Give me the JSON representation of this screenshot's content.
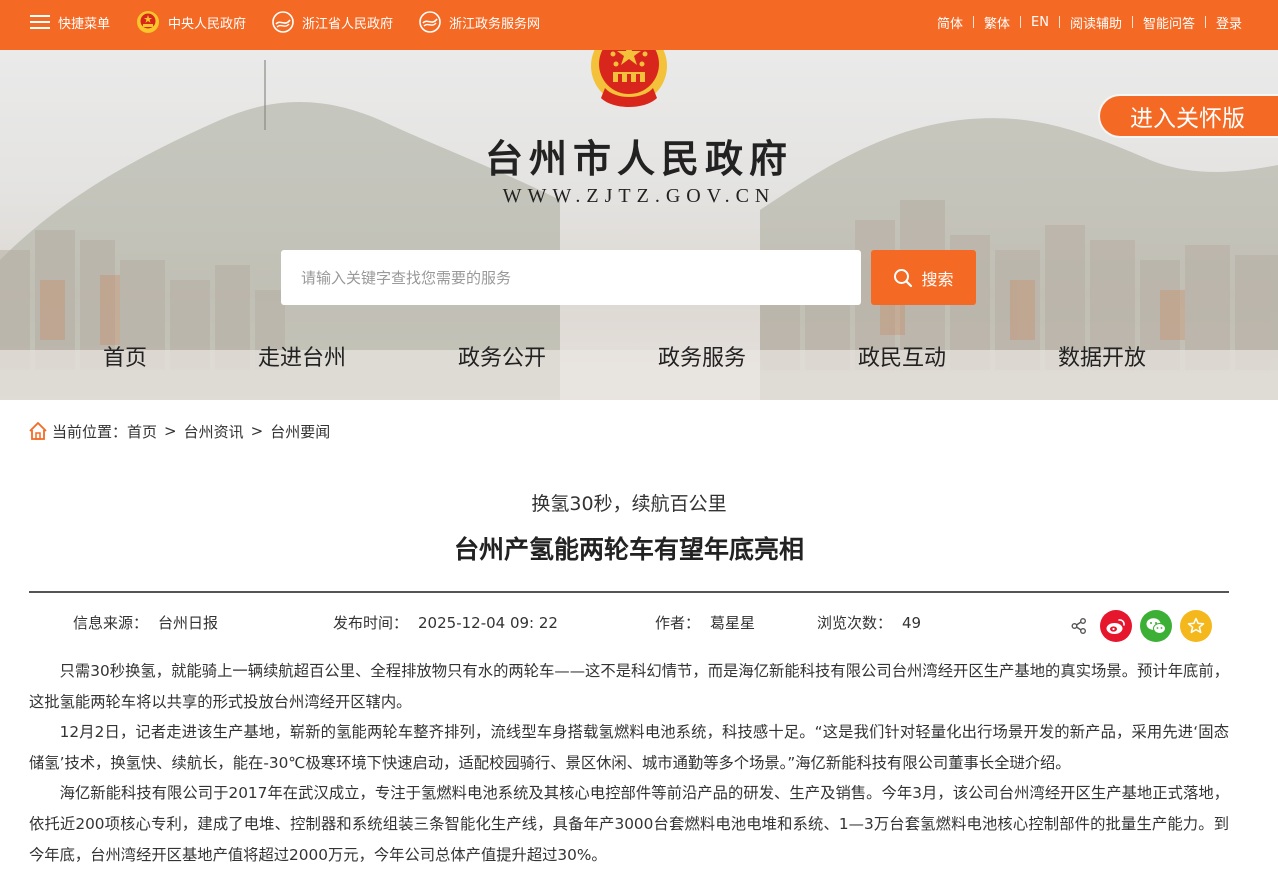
{
  "topbar": {
    "left": [
      {
        "label": "快捷菜单",
        "icon": "menu-icon"
      },
      {
        "label": "中央人民政府",
        "icon": "national-emblem-icon"
      },
      {
        "label": "浙江省人民政府",
        "icon": "zhejiang-logo-icon"
      },
      {
        "label": "浙江政务服务网",
        "icon": "zhejiang-service-logo-icon"
      }
    ],
    "right": [
      "简体",
      "繁体",
      "EN",
      "阅读辅助",
      "智能问答",
      "登录"
    ]
  },
  "banner": {
    "title": "台州市人民政府",
    "url": "WWW.ZJTZ.GOV.CN",
    "care_button": "进入关怀版",
    "search_placeholder": "请输入关键字查找您需要的服务",
    "search_button": "搜索"
  },
  "nav": [
    "首页",
    "走进台州",
    "政务公开",
    "政务服务",
    "政民互动",
    "数据开放"
  ],
  "breadcrumb": {
    "prefix": "当前位置：",
    "items": [
      "首页",
      "台州资讯",
      "台州要闻"
    ],
    "separator": ">"
  },
  "article": {
    "subtitle": "换氢30秒，续航百公里",
    "title": "台州产氢能两轮车有望年底亮相",
    "meta": {
      "source_label": "信息来源：",
      "source": "台州日报",
      "date_label": "发布时间：",
      "date": "2025-12-04 09: 22",
      "author_label": "作者：",
      "author": "葛星星",
      "views_label": "浏览次数：",
      "views": "49"
    },
    "share_icons": [
      "share-icon",
      "weibo-icon",
      "wechat-icon",
      "favorite-icon"
    ],
    "paragraphs": [
      "只需30秒换氢，就能骑上一辆续航超百公里、全程排放物只有水的两轮车——这不是科幻情节，而是海亿新能科技有限公司台州湾经开区生产基地的真实场景。预计年底前，这批氢能两轮车将以共享的形式投放台州湾经开区辖内。",
      "12月2日，记者走进该生产基地，崭新的氢能两轮车整齐排列，流线型车身搭载氢燃料电池系统，科技感十足。“这是我们针对轻量化出行场景开发的新产品，采用先进‘固态储氢’技术，换氢快、续航长，能在-30℃极寒环境下快速启动，适配校园骑行、景区休闲、城市通勤等多个场景。”海亿新能科技有限公司董事长全琎介绍。",
      "海亿新能科技有限公司于2017年在武汉成立，专注于氢燃料电池系统及其核心电控部件等前沿产品的研发、生产及销售。今年3月，该公司台州湾经开区生产基地正式落地，依托近200项核心专利，建成了电堆、控制器和系统组装三条智能化生产线，具备年产3000台套燃料电池电堆和系统、1—3万台套氢燃料电池核心控制部件的批量生产能力。到今年底，台州湾经开区基地产值将超过2000万元，今年公司总体产值提升超过30%。"
    ]
  },
  "colors": {
    "accent": "#f46a24",
    "weibo": "#e6162d",
    "wechat": "#3cb034",
    "favorite": "#f5b81c"
  }
}
